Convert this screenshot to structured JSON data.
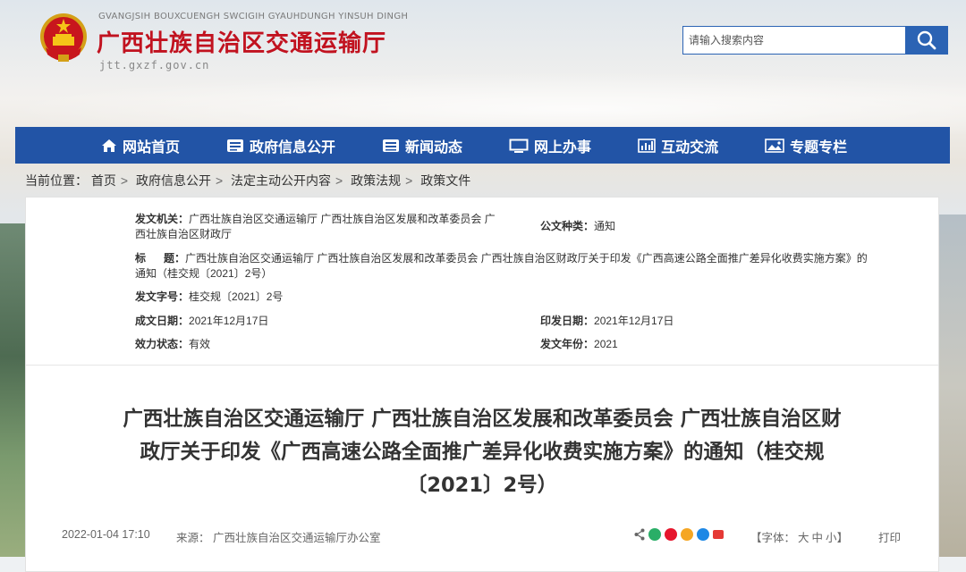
{
  "header": {
    "latin_name": "GVANGJSIH BOUXCUENGH SWCIGIH GYAUHDUNGH YINSUH DINGH",
    "title": "广西壮族自治区交通运输厅",
    "domain": "jtt.gxzf.gov.cn",
    "search_placeholder": "请输入搜索内容"
  },
  "nav": {
    "items": [
      {
        "label": "网站首页",
        "icon": "home-icon"
      },
      {
        "label": "政府信息公开",
        "icon": "document-icon"
      },
      {
        "label": "新闻动态",
        "icon": "news-icon"
      },
      {
        "label": "网上办事",
        "icon": "monitor-icon"
      },
      {
        "label": "互动交流",
        "icon": "chart-icon"
      },
      {
        "label": "专题专栏",
        "icon": "image-icon"
      }
    ]
  },
  "breadcrumb": {
    "prefix": "当前位置：",
    "items": [
      "首页",
      "政府信息公开",
      "法定主动公开内容",
      "政策法规",
      "政策文件"
    ]
  },
  "meta": {
    "issuer_label": "发文机关：",
    "issuer_line1": "广西壮族自治区交通运输厅  广西壮族自治区发展和改革委员会  广",
    "issuer_line2": "西壮族自治区财政厅",
    "doc_type_label": "公文种类：",
    "doc_type": "通知",
    "title_label": "标      题：",
    "title_line1": "广西壮族自治区交通运输厅  广西壮族自治区发展和改革委员会  广西壮族自治区财政厅关于印发《广西高速公路全面推广差异化收费实施方案》的",
    "title_line2": "通知（桂交规〔2021〕2号）",
    "doc_no_label": "发文字号：",
    "doc_no": "桂交规〔2021〕2号",
    "written_date_label": "成文日期：",
    "written_date": "2021年12月17日",
    "issue_date_label": "印发日期：",
    "issue_date": "2021年12月17日",
    "status_label": "效力状态：",
    "status": "有效",
    "year_label": "发文年份：",
    "year": "2021"
  },
  "article": {
    "title_line1": "广西壮族自治区交通运输厅  广西壮族自治区发展和改革委员会  广西壮族自治区财",
    "title_line2": "政厅关于印发《广西高速公路全面推广差异化收费实施方案》的通知（桂交规",
    "title_line3": "〔2021〕2号）",
    "publish_time": "2022-01-04 17:10",
    "source": "来源：  广西壮族自治区交通运输厅办公室",
    "font_label_open": "【字体：",
    "font_large": "大",
    "font_medium": "中",
    "font_small": "小",
    "font_label_close": "】",
    "print": "打印"
  },
  "colors": {
    "brand_red": "#c1121f",
    "nav_blue": "#2254a6",
    "search_blue": "#2b63b4"
  }
}
